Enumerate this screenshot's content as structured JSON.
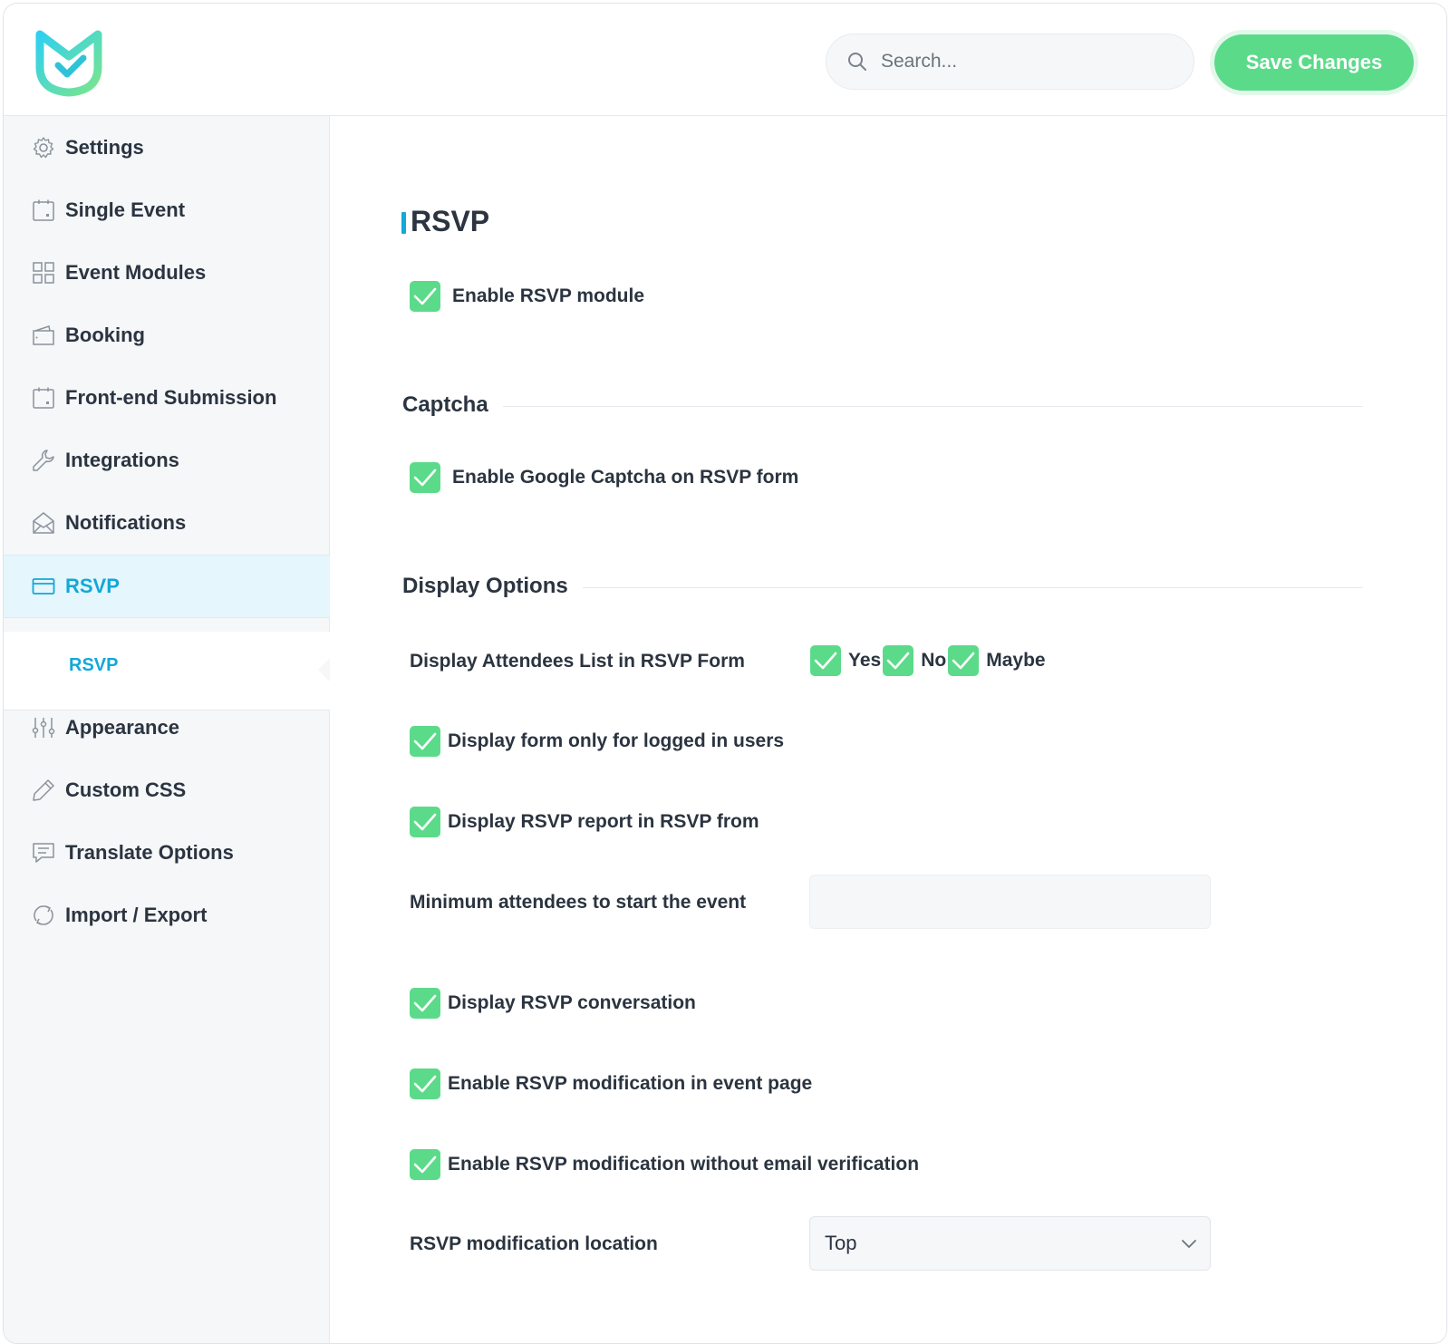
{
  "header": {
    "search_placeholder": "Search...",
    "save_label": "Save Changes",
    "accent_color": "#5bdb8a"
  },
  "sidebar": {
    "items": [
      {
        "label": "Settings",
        "icon": "gear-icon"
      },
      {
        "label": "Single Event",
        "icon": "calendar-icon"
      },
      {
        "label": "Event Modules",
        "icon": "grid-icon"
      },
      {
        "label": "Booking",
        "icon": "wallet-icon"
      },
      {
        "label": "Front-end Submission",
        "icon": "calendar-icon"
      },
      {
        "label": "Integrations",
        "icon": "wrench-icon"
      },
      {
        "label": "Notifications",
        "icon": "envelope-icon"
      },
      {
        "label": "RSVP",
        "icon": "card-icon",
        "active": true
      },
      {
        "label": "Appearance",
        "icon": "sliders-icon"
      },
      {
        "label": "Custom CSS",
        "icon": "pencil-icon"
      },
      {
        "label": "Translate Options",
        "icon": "comment-icon"
      },
      {
        "label": "Import / Export",
        "icon": "refresh-icon"
      }
    ],
    "sub_items": [
      {
        "label": "RSVP"
      }
    ],
    "active_color": "#12a8d8"
  },
  "main": {
    "title": "RSVP",
    "enable_rsvp": {
      "label": "Enable RSVP module",
      "checked": true
    },
    "captcha": {
      "title": "Captcha",
      "enable_google_captcha": {
        "label": "Enable Google Captcha on RSVP form",
        "checked": true
      }
    },
    "display_options": {
      "title": "Display Options",
      "attendees_list": {
        "label": "Display Attendees List in RSVP Form",
        "options": [
          {
            "label": "Yes",
            "checked": true
          },
          {
            "label": "No",
            "checked": true
          },
          {
            "label": "Maybe",
            "checked": true
          }
        ]
      },
      "logged_in_only": {
        "label": "Display form only for logged in users",
        "checked": true
      },
      "rsvp_report": {
        "label": "Display RSVP report in RSVP from",
        "checked": true
      },
      "min_attendees": {
        "label": "Minimum attendees to start the event",
        "value": ""
      },
      "conversation": {
        "label": "Display RSVP conversation",
        "checked": true
      },
      "modification_event_page": {
        "label": "Enable RSVP modification in event page",
        "checked": true
      },
      "modification_no_email": {
        "label": "Enable RSVP modification without email verification",
        "checked": true
      },
      "modification_location": {
        "label": "RSVP modification location",
        "value": "Top"
      }
    }
  }
}
